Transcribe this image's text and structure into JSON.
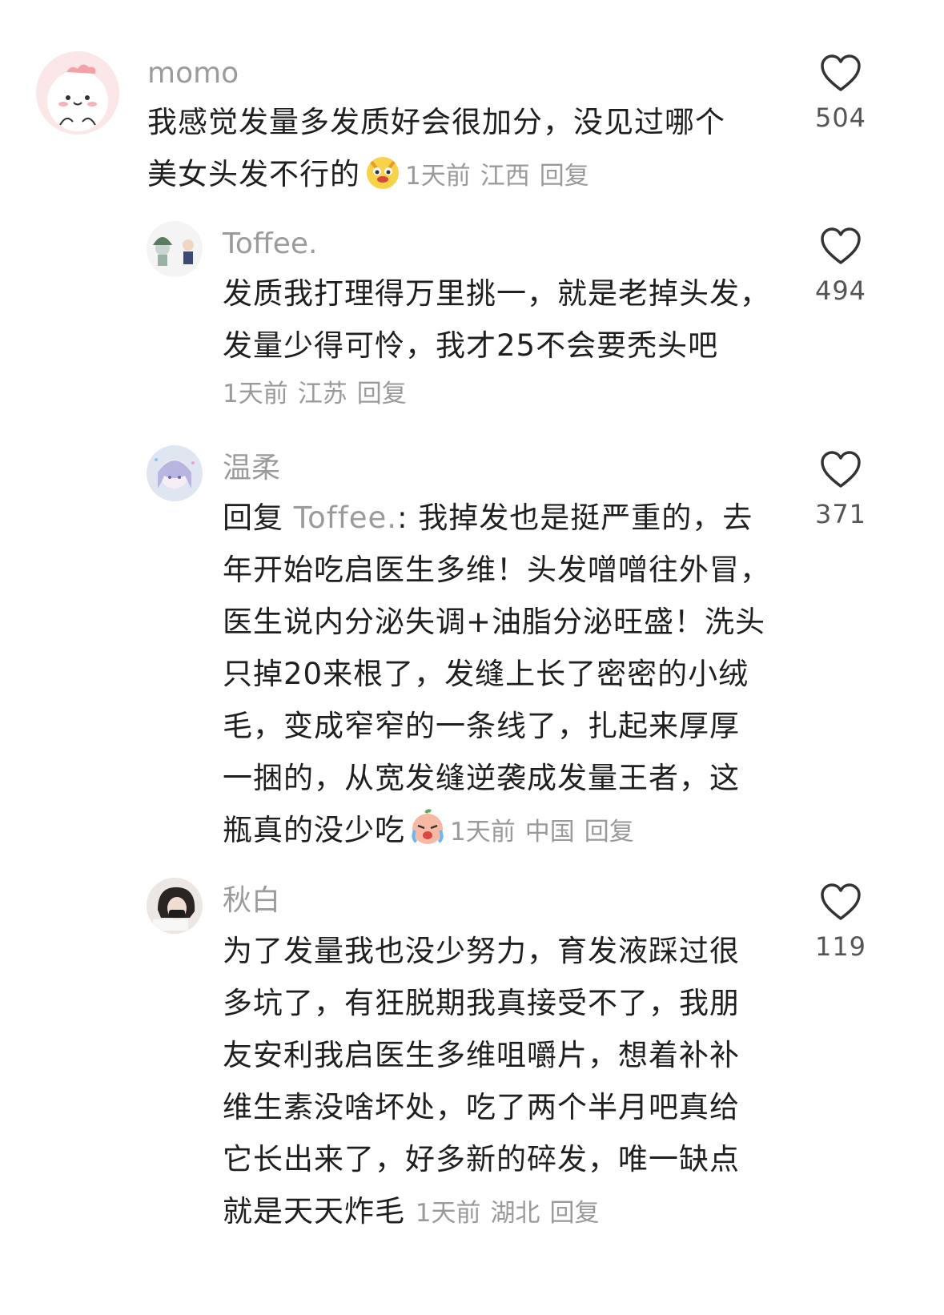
{
  "comments": [
    {
      "username": "momo",
      "lines": [
        "我感觉发量多发质好会很加分，没见过哪个",
        "美女头发不行的"
      ],
      "emoji": "dog-face-emoji",
      "time": "1天前",
      "location": "江西",
      "reply_label": "回复",
      "likes": "504"
    },
    {
      "username": "Toffee.",
      "lines": [
        "发质我打理得万里挑一，就是老掉头发，",
        "发量少得可怜，我才25不会要秃头吧"
      ],
      "time": "1天前",
      "location": "江苏",
      "reply_label": "回复",
      "likes": "494"
    },
    {
      "username": "温柔",
      "reply_prefix": "回复 ",
      "reply_target": "Toffee.",
      "first_line_rest": ": 我掉发也是挺严重的，去",
      "lines": [
        "年开始吃启医生多维！头发噌噌往外冒，",
        "医生说内分泌失调+油脂分泌旺盛！洗头",
        "只掉20来根了，发缝上长了密密的小绒",
        "毛，变成窄窄的一条线了，扎起来厚厚",
        "一捆的，从宽发缝逆袭成发量王者，这",
        "瓶真的没少吃"
      ],
      "emoji": "crying-face-emoji",
      "time": "1天前",
      "location": "中国",
      "reply_label": "回复",
      "likes": "371"
    },
    {
      "username": "秋白",
      "lines": [
        "为了发量我也没少努力，育发液踩过很",
        "多坑了，有狂脱期我真接受不了，我朋",
        "友安利我启医生多维咀嚼片，想着补补",
        "维生素没啥坏处，吃了两个半月吧真给",
        "它长出来了，好多新的碎发，唯一缺点",
        "就是天天炸毛"
      ],
      "time": "1天前",
      "location": "湖北",
      "reply_label": "回复",
      "likes": "119"
    }
  ],
  "colors": {
    "name": "#9b9b9b",
    "text": "#1f1f1f",
    "meta": "#9a9a9a",
    "count": "#555555"
  },
  "icons": {
    "like": "heart-outline-icon"
  }
}
